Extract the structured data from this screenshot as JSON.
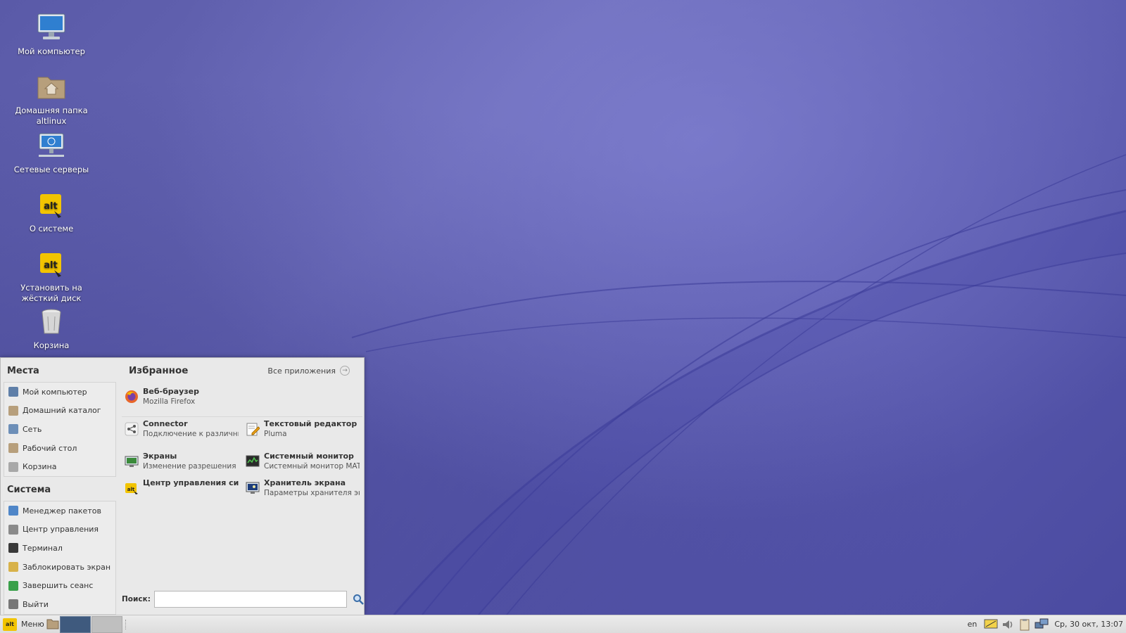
{
  "desktop": {
    "icons": [
      {
        "label": "Мой компьютер",
        "icon": "computer-icon"
      },
      {
        "label": "Домашняя папка altlinux",
        "icon": "home-folder-icon"
      },
      {
        "label": "Сетевые серверы",
        "icon": "network-servers-icon"
      },
      {
        "label": "О системе",
        "icon": "basealt-logo-icon"
      },
      {
        "label": "Установить на жёсткий диск",
        "icon": "installer-icon"
      },
      {
        "label": "Корзина",
        "icon": "trash-icon"
      }
    ]
  },
  "menu": {
    "places": {
      "title": "Места",
      "items": [
        {
          "label": "Мой компьютер",
          "icon": "computer-icon"
        },
        {
          "label": "Домашний каталог",
          "icon": "home-folder-icon"
        },
        {
          "label": "Сеть",
          "icon": "network-icon"
        },
        {
          "label": "Рабочий стол",
          "icon": "desktop-folder-icon"
        },
        {
          "label": "Корзина",
          "icon": "trash-icon"
        }
      ]
    },
    "system": {
      "title": "Система",
      "items": [
        {
          "label": "Менеджер пакетов",
          "icon": "package-manager-icon"
        },
        {
          "label": "Центр управления",
          "icon": "control-center-icon"
        },
        {
          "label": "Терминал",
          "icon": "terminal-icon"
        },
        {
          "label": "Заблокировать экран",
          "icon": "lock-screen-icon"
        },
        {
          "label": "Завершить сеанс",
          "icon": "logout-icon"
        },
        {
          "label": "Выйти",
          "icon": "quit-icon"
        }
      ]
    },
    "favorites": {
      "title": "Избранное",
      "all_apps_label": "Все приложения",
      "apps": [
        {
          "name": "Веб-браузер",
          "desc": "Mozilla Firefox",
          "icon": "firefox-icon"
        },
        {
          "name": "Connector",
          "desc": "Подключение к различны...",
          "icon": "connector-icon"
        },
        {
          "name": "Текстовый редактор",
          "desc": "Pluma",
          "icon": "text-editor-icon"
        },
        {
          "name": "Экраны",
          "desc": "Изменение разрешения ...",
          "icon": "displays-icon"
        },
        {
          "name": "Системный монитор",
          "desc": "Системный монитор MATE",
          "icon": "system-monitor-icon"
        },
        {
          "name": "Центр управления сист...",
          "desc": "",
          "icon": "alt-control-center-icon"
        },
        {
          "name": "Хранитель экрана",
          "desc": "Параметры хранителя экр...",
          "icon": "screensaver-icon"
        }
      ]
    },
    "search": {
      "label": "Поиск:",
      "value": "",
      "placeholder": ""
    }
  },
  "taskbar": {
    "menu_label": "Меню",
    "menu_logo_text": "alt",
    "keyboard_layout": "en",
    "clock": "Ср, 30 окт, 13:07"
  },
  "colors": {
    "wallpaper": "#5a5aa8",
    "panel": "#e9e9e9",
    "accent_logo": "#f2c400"
  }
}
